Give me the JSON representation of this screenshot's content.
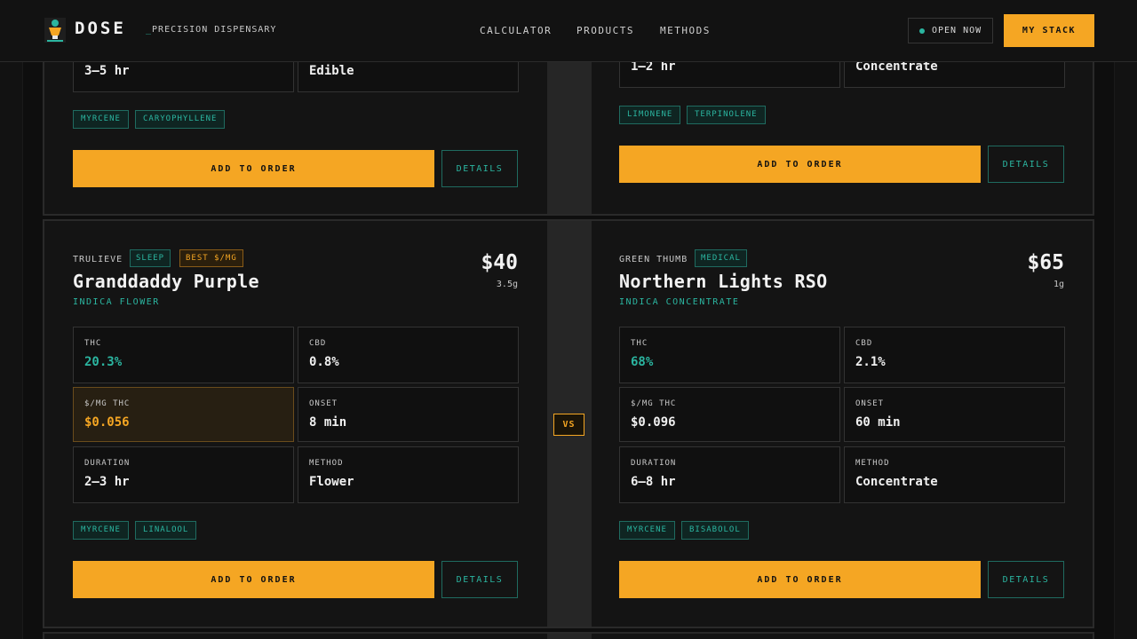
{
  "header": {
    "logo": "DOSE",
    "tagline_prefix": "_",
    "tagline": "PRECISION DISPENSARY",
    "nav": [
      "CALCULATOR",
      "PRODUCTS",
      "METHODS"
    ],
    "status": "OPEN NOW",
    "stack_button": "MY STACK"
  },
  "colors": {
    "accent": "#f5a623",
    "teal": "#2bb5a0",
    "background": "#0e0e0e"
  },
  "top_row": {
    "left": {
      "stats": [
        {
          "value": "3–5 hr"
        },
        {
          "value": "Edible"
        }
      ],
      "terpenes": [
        "MYRCENE",
        "CARYOPHYLLENE"
      ],
      "add_label": "ADD TO ORDER",
      "details_label": "DETAILS"
    },
    "right": {
      "stats": [
        {
          "value": "1–2 hr"
        },
        {
          "value": "Concentrate"
        }
      ],
      "terpenes": [
        "LIMONENE",
        "TERPINOLENE"
      ],
      "add_label": "ADD TO ORDER",
      "details_label": "DETAILS"
    }
  },
  "vs_label": "VS",
  "compare": {
    "left": {
      "brand": "TRULIEVE",
      "tags": [
        "SLEEP",
        "BEST $/MG"
      ],
      "name": "Granddaddy Purple",
      "category": "INDICA FLOWER",
      "price": "$40",
      "size": "3.5g",
      "stats": [
        {
          "label": "THC",
          "value": "20.3%"
        },
        {
          "label": "CBD",
          "value": "0.8%"
        },
        {
          "label": "$/MG THC",
          "value": "$0.056"
        },
        {
          "label": "ONSET",
          "value": "8 min"
        },
        {
          "label": "DURATION",
          "value": "2–3 hr"
        },
        {
          "label": "METHOD",
          "value": "Flower"
        }
      ],
      "terpenes": [
        "MYRCENE",
        "LINALOOL"
      ],
      "add_label": "ADD TO ORDER",
      "details_label": "DETAILS"
    },
    "right": {
      "brand": "GREEN THUMB",
      "tags": [
        "MEDICAL"
      ],
      "name": "Northern Lights RSO",
      "category": "INDICA CONCENTRATE",
      "price": "$65",
      "size": "1g",
      "stats": [
        {
          "label": "THC",
          "value": "68%"
        },
        {
          "label": "CBD",
          "value": "2.1%"
        },
        {
          "label": "$/MG THC",
          "value": "$0.096"
        },
        {
          "label": "ONSET",
          "value": "60 min"
        },
        {
          "label": "DURATION",
          "value": "6–8 hr"
        },
        {
          "label": "METHOD",
          "value": "Concentrate"
        }
      ],
      "terpenes": [
        "MYRCENE",
        "BISABOLOL"
      ],
      "add_label": "ADD TO ORDER",
      "details_label": "DETAILS"
    }
  }
}
